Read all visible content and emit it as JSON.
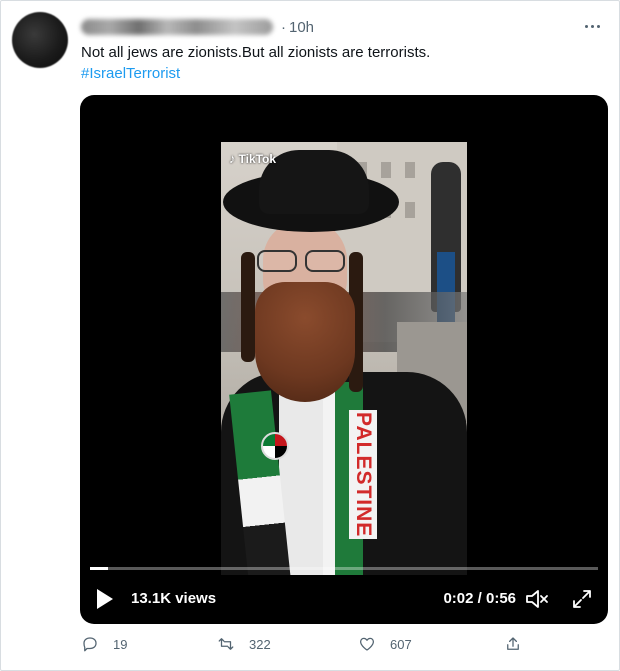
{
  "tweet": {
    "time": "10h",
    "dot": "·",
    "text": "Not all jews are zionists.But all zionists are terrorists.",
    "hashtag": "#IsraelTerrorist"
  },
  "video": {
    "watermark": "TikTok",
    "scarf_text": "PALESTINE",
    "views": "13.1K views",
    "timecode": "0:02 / 0:56",
    "progress": 0.036
  },
  "actions": {
    "replies": "19",
    "retweets": "322",
    "likes": "607"
  },
  "icons": [
    "more-icon",
    "play-icon",
    "mute-icon",
    "fullscreen-icon",
    "reply-icon",
    "retweet-icon",
    "like-icon",
    "share-icon"
  ]
}
